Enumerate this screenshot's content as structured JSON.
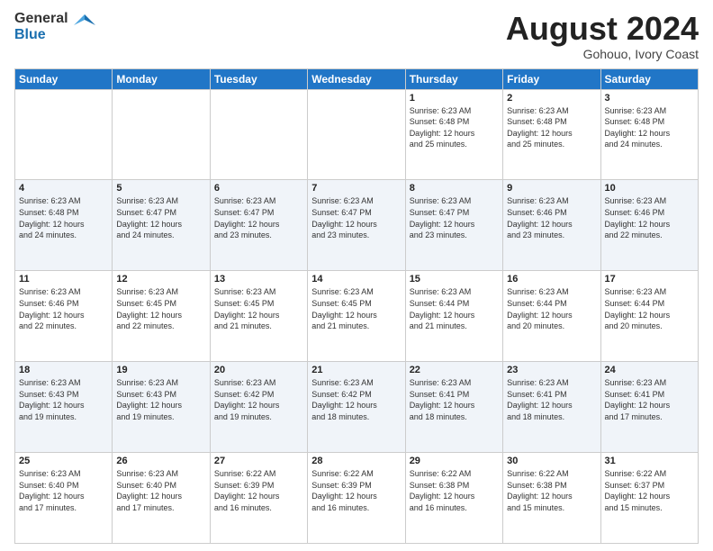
{
  "logo": {
    "general": "General",
    "blue": "Blue"
  },
  "title": {
    "month_year": "August 2024",
    "location": "Gohouo, Ivory Coast"
  },
  "days_of_week": [
    "Sunday",
    "Monday",
    "Tuesday",
    "Wednesday",
    "Thursday",
    "Friday",
    "Saturday"
  ],
  "weeks": [
    [
      {
        "day": "",
        "info": ""
      },
      {
        "day": "",
        "info": ""
      },
      {
        "day": "",
        "info": ""
      },
      {
        "day": "",
        "info": ""
      },
      {
        "day": "1",
        "info": "Sunrise: 6:23 AM\nSunset: 6:48 PM\nDaylight: 12 hours\nand 25 minutes."
      },
      {
        "day": "2",
        "info": "Sunrise: 6:23 AM\nSunset: 6:48 PM\nDaylight: 12 hours\nand 25 minutes."
      },
      {
        "day": "3",
        "info": "Sunrise: 6:23 AM\nSunset: 6:48 PM\nDaylight: 12 hours\nand 24 minutes."
      }
    ],
    [
      {
        "day": "4",
        "info": "Sunrise: 6:23 AM\nSunset: 6:48 PM\nDaylight: 12 hours\nand 24 minutes."
      },
      {
        "day": "5",
        "info": "Sunrise: 6:23 AM\nSunset: 6:47 PM\nDaylight: 12 hours\nand 24 minutes."
      },
      {
        "day": "6",
        "info": "Sunrise: 6:23 AM\nSunset: 6:47 PM\nDaylight: 12 hours\nand 23 minutes."
      },
      {
        "day": "7",
        "info": "Sunrise: 6:23 AM\nSunset: 6:47 PM\nDaylight: 12 hours\nand 23 minutes."
      },
      {
        "day": "8",
        "info": "Sunrise: 6:23 AM\nSunset: 6:47 PM\nDaylight: 12 hours\nand 23 minutes."
      },
      {
        "day": "9",
        "info": "Sunrise: 6:23 AM\nSunset: 6:46 PM\nDaylight: 12 hours\nand 23 minutes."
      },
      {
        "day": "10",
        "info": "Sunrise: 6:23 AM\nSunset: 6:46 PM\nDaylight: 12 hours\nand 22 minutes."
      }
    ],
    [
      {
        "day": "11",
        "info": "Sunrise: 6:23 AM\nSunset: 6:46 PM\nDaylight: 12 hours\nand 22 minutes."
      },
      {
        "day": "12",
        "info": "Sunrise: 6:23 AM\nSunset: 6:45 PM\nDaylight: 12 hours\nand 22 minutes."
      },
      {
        "day": "13",
        "info": "Sunrise: 6:23 AM\nSunset: 6:45 PM\nDaylight: 12 hours\nand 21 minutes."
      },
      {
        "day": "14",
        "info": "Sunrise: 6:23 AM\nSunset: 6:45 PM\nDaylight: 12 hours\nand 21 minutes."
      },
      {
        "day": "15",
        "info": "Sunrise: 6:23 AM\nSunset: 6:44 PM\nDaylight: 12 hours\nand 21 minutes."
      },
      {
        "day": "16",
        "info": "Sunrise: 6:23 AM\nSunset: 6:44 PM\nDaylight: 12 hours\nand 20 minutes."
      },
      {
        "day": "17",
        "info": "Sunrise: 6:23 AM\nSunset: 6:44 PM\nDaylight: 12 hours\nand 20 minutes."
      }
    ],
    [
      {
        "day": "18",
        "info": "Sunrise: 6:23 AM\nSunset: 6:43 PM\nDaylight: 12 hours\nand 19 minutes."
      },
      {
        "day": "19",
        "info": "Sunrise: 6:23 AM\nSunset: 6:43 PM\nDaylight: 12 hours\nand 19 minutes."
      },
      {
        "day": "20",
        "info": "Sunrise: 6:23 AM\nSunset: 6:42 PM\nDaylight: 12 hours\nand 19 minutes."
      },
      {
        "day": "21",
        "info": "Sunrise: 6:23 AM\nSunset: 6:42 PM\nDaylight: 12 hours\nand 18 minutes."
      },
      {
        "day": "22",
        "info": "Sunrise: 6:23 AM\nSunset: 6:41 PM\nDaylight: 12 hours\nand 18 minutes."
      },
      {
        "day": "23",
        "info": "Sunrise: 6:23 AM\nSunset: 6:41 PM\nDaylight: 12 hours\nand 18 minutes."
      },
      {
        "day": "24",
        "info": "Sunrise: 6:23 AM\nSunset: 6:41 PM\nDaylight: 12 hours\nand 17 minutes."
      }
    ],
    [
      {
        "day": "25",
        "info": "Sunrise: 6:23 AM\nSunset: 6:40 PM\nDaylight: 12 hours\nand 17 minutes."
      },
      {
        "day": "26",
        "info": "Sunrise: 6:23 AM\nSunset: 6:40 PM\nDaylight: 12 hours\nand 17 minutes."
      },
      {
        "day": "27",
        "info": "Sunrise: 6:22 AM\nSunset: 6:39 PM\nDaylight: 12 hours\nand 16 minutes."
      },
      {
        "day": "28",
        "info": "Sunrise: 6:22 AM\nSunset: 6:39 PM\nDaylight: 12 hours\nand 16 minutes."
      },
      {
        "day": "29",
        "info": "Sunrise: 6:22 AM\nSunset: 6:38 PM\nDaylight: 12 hours\nand 16 minutes."
      },
      {
        "day": "30",
        "info": "Sunrise: 6:22 AM\nSunset: 6:38 PM\nDaylight: 12 hours\nand 15 minutes."
      },
      {
        "day": "31",
        "info": "Sunrise: 6:22 AM\nSunset: 6:37 PM\nDaylight: 12 hours\nand 15 minutes."
      }
    ]
  ]
}
